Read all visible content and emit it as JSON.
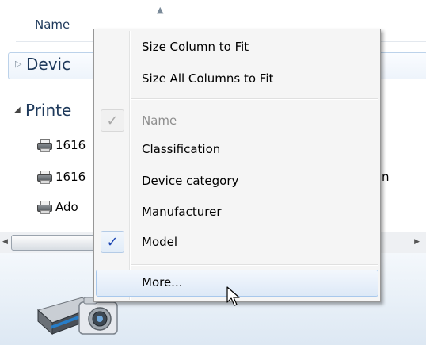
{
  "header": {
    "column_name": "Name",
    "sort_indicator": "▲"
  },
  "groups": [
    {
      "label": "Devic",
      "expanded": false,
      "arrow": "▷"
    },
    {
      "label": "Printe",
      "expanded": true,
      "arrow": "◢"
    }
  ],
  "printer_rows": [
    {
      "label": "1616",
      "icon": "fax-printer-icon"
    },
    {
      "label": "1616",
      "icon": "printer-icon"
    },
    {
      "label": "Ado",
      "icon": "printer-icon"
    }
  ],
  "partial_text": "n",
  "scrollbar": {
    "left_arrow": "◀",
    "right_arrow": "▶"
  },
  "context_menu": {
    "items": [
      {
        "label": "Size Column to Fit"
      },
      {
        "label": "Size All Columns to Fit"
      },
      {
        "label": "Name",
        "checked": true,
        "disabled": true
      },
      {
        "label": "Classification"
      },
      {
        "label": "Device category"
      },
      {
        "label": "Manufacturer"
      },
      {
        "label": "Model",
        "checked": true
      },
      {
        "label": "More...",
        "highlighted": true
      }
    ],
    "check_glyph": "✓"
  },
  "colors": {
    "menu_background": "#f5f5f5",
    "highlight_border": "#a8c8ec",
    "check_color": "#1f48b4"
  }
}
